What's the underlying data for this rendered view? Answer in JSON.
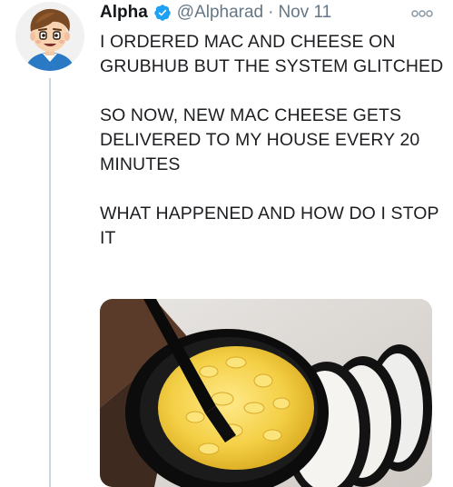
{
  "tweet": {
    "author_name": "Alpha",
    "handle": "@Alpharad",
    "separator": "·",
    "date": "Nov 11",
    "paragraphs": [
      "I ORDERED MAC AND CHEESE ON GRUBHUB BUT THE SYSTEM GLITCHED",
      "SO NOW, NEW MAC CHEESE GETS DELIVERED TO MY HOUSE EVERY 20 MINUTES",
      "WHAT HAPPENED AND HOW DO I STOP IT"
    ]
  },
  "icons": {
    "verified": "verified-badge-icon",
    "more": "more-options-icon"
  },
  "colors": {
    "verified_blue": "#1da1f2",
    "secondary_text": "#657786",
    "primary_text": "#14171a"
  }
}
